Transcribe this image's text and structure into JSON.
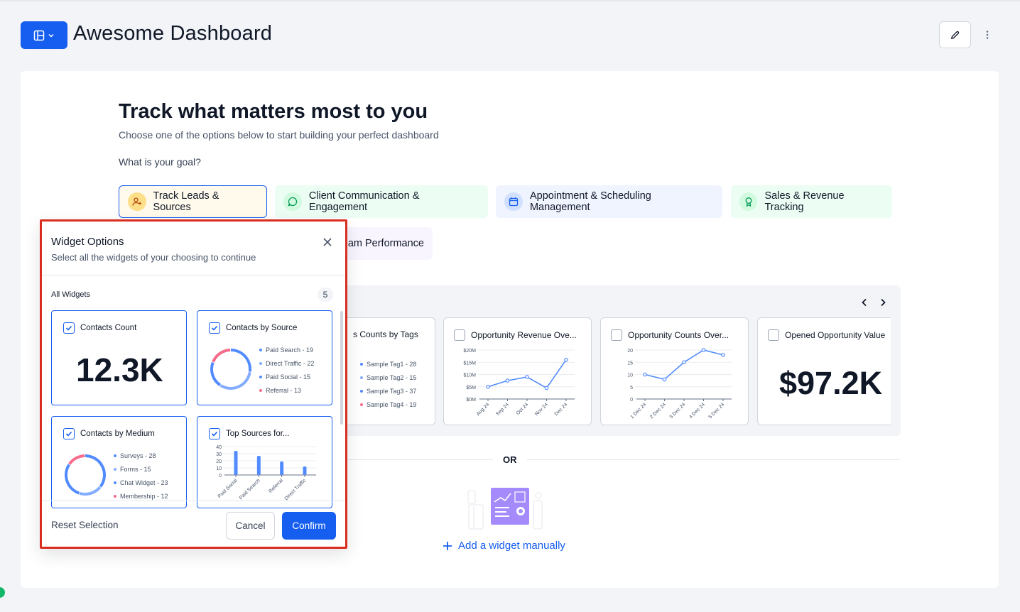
{
  "header": {
    "title": "Awesome Dashboard",
    "layout_icon": "layout-grid-icon",
    "edit_icon": "pencil-icon",
    "more_icon": "vertical-dots-icon"
  },
  "intro": {
    "heading": "Track what matters most to you",
    "subheading": "Choose one of the options below to start building your perfect dashboard",
    "goal_question": "What is your goal?"
  },
  "goals": [
    {
      "label": "Track Leads & Sources",
      "icon": "user-plus-icon",
      "selected": true
    },
    {
      "label": "Client Communication & Engagement",
      "icon": "chat-icon",
      "selected": false
    },
    {
      "label": "Appointment & Scheduling Management",
      "icon": "calendar-icon",
      "selected": false
    },
    {
      "label": "Sales & Revenue Tracking",
      "icon": "award-icon",
      "selected": false
    },
    {
      "label": "eam Performance",
      "icon": "",
      "selected": false
    }
  ],
  "carousel": {
    "cards": [
      {
        "title": "s Counts by Tags",
        "legend": [
          "Sample Tag1 - 28",
          "Sample Tag2 - 15",
          "Sample Tag3 - 37",
          "Sample Tag4 - 19"
        ]
      },
      {
        "title": "Opportunity Revenue Ove...",
        "y_ticks": [
          "$20M",
          "$15M",
          "$10M",
          "$5M",
          "$0M"
        ],
        "x_ticks": [
          "Aug 24",
          "Sep 24",
          "Oct 24",
          "Nov 24",
          "Dec 24"
        ]
      },
      {
        "title": "Opportunity Counts Over...",
        "y_ticks": [
          "20",
          "15",
          "10",
          "5",
          "0"
        ],
        "x_ticks": [
          "1 Dec 24",
          "2 Dec 24",
          "3 Dec 24",
          "4 Dec 24",
          "5 Dec 24"
        ]
      },
      {
        "title": "Opened Opportunity Value",
        "value": "$97.2K"
      }
    ]
  },
  "or_label": "OR",
  "add_widget": "Add a widget manually",
  "modal": {
    "title": "Widget Options",
    "subtitle": "Select all the widgets of your choosing to continue",
    "all_widgets_label": "All Widgets",
    "count": "5",
    "cards": [
      {
        "title": "Contacts Count",
        "value": "12.3K"
      },
      {
        "title": "Contacts by Source",
        "legend": [
          "Paid Search - 19",
          "Direct Traffic - 22",
          "Paid Social - 15",
          "Referral - 13"
        ]
      },
      {
        "title": "Contacts by Medium",
        "legend": [
          "Surveys - 28",
          "Forms - 15",
          "Chat Widget - 23",
          "Membership - 12"
        ]
      },
      {
        "title": "Top Sources for...",
        "y_ticks": [
          "40",
          "30",
          "20",
          "10",
          "0"
        ],
        "x_ticks": [
          "Paid Social",
          "Paid Search",
          "Referral",
          "Direct Traffic"
        ]
      }
    ],
    "reset": "Reset Selection",
    "cancel": "Cancel",
    "confirm": "Confirm"
  },
  "colors": {
    "primary": "#155eef",
    "highlight_border": "#d92d20",
    "series_blue": "#528bff",
    "series_pink": "#f76c8b",
    "series_light": "#84adff"
  },
  "chart_data": [
    {
      "type": "line",
      "title": "Opportunity Revenue Ove...",
      "categories": [
        "Aug 24",
        "Sep 24",
        "Oct 24",
        "Nov 24",
        "Dec 24"
      ],
      "values": [
        5,
        7.5,
        9,
        4.5,
        16
      ],
      "ylim": [
        0,
        20
      ]
    },
    {
      "type": "line",
      "title": "Opportunity Counts Over...",
      "categories": [
        "1 Dec 24",
        "2 Dec 24",
        "3 Dec 24",
        "4 Dec 24",
        "5 Dec 24"
      ],
      "values": [
        10,
        8,
        15,
        20,
        18
      ],
      "ylim": [
        0,
        20
      ]
    },
    {
      "type": "bar",
      "title": "Top Sources for...",
      "categories": [
        "Paid Social",
        "Paid Search",
        "Referral",
        "Direct Traffic"
      ],
      "values": [
        34,
        27,
        19,
        12
      ],
      "ylim": [
        0,
        40
      ]
    },
    {
      "type": "pie",
      "title": "Contacts by Source",
      "categories": [
        "Paid Search",
        "Direct Traffic",
        "Paid Social",
        "Referral"
      ],
      "values": [
        19,
        22,
        15,
        13
      ]
    },
    {
      "type": "pie",
      "title": "Contacts by Medium",
      "categories": [
        "Surveys",
        "Forms",
        "Chat Widget",
        "Membership"
      ],
      "values": [
        28,
        15,
        23,
        12
      ]
    }
  ]
}
